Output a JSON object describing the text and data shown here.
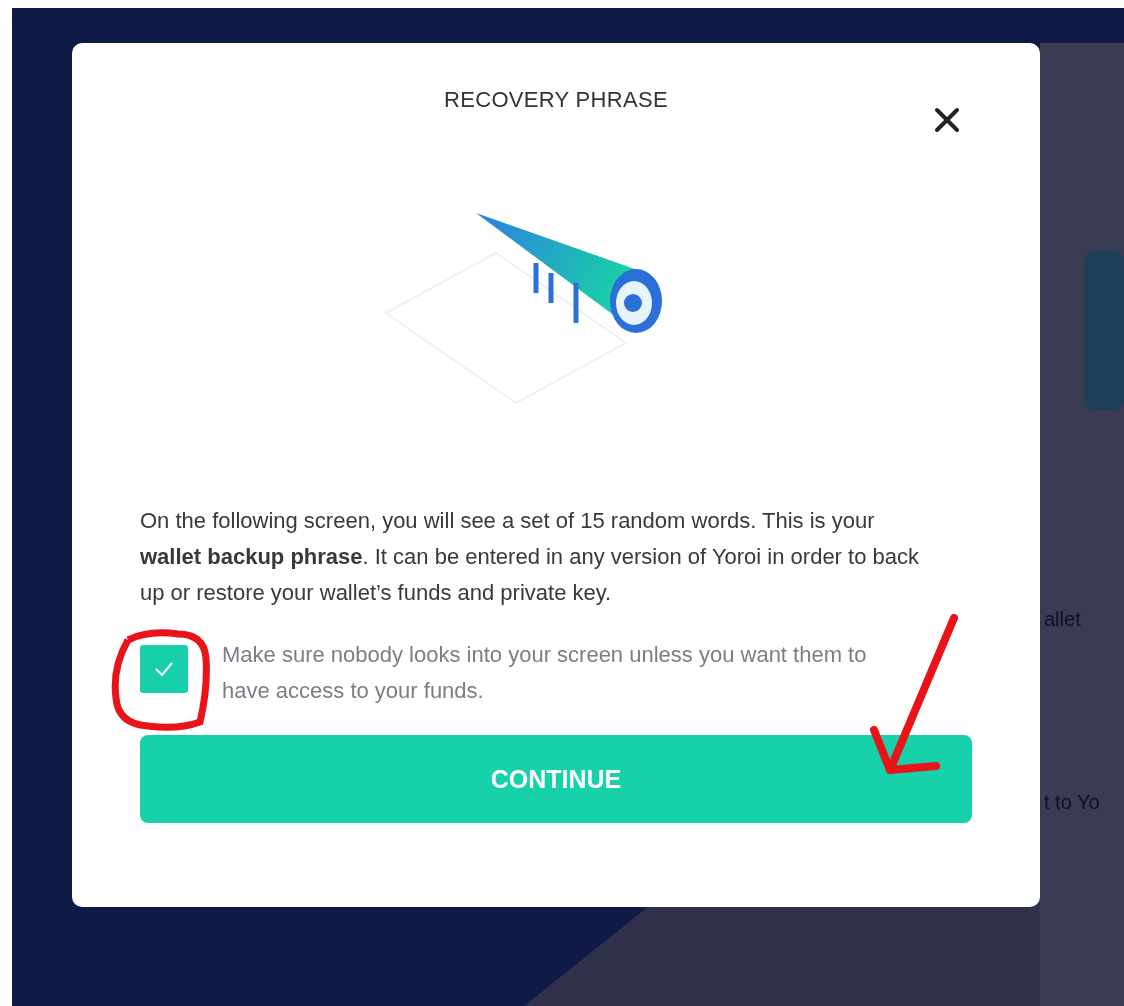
{
  "background": {
    "texts": [
      "allet",
      "t to Yo"
    ]
  },
  "dialog": {
    "title": "RECOVERY PHRASE",
    "message": "On the following screen, you will see a set of 15 random words. This is your **wallet backup phrase**. It can be entered in any version of Yoroi in order to back up or restore your wallet’s funds and private key.",
    "checkbox": {
      "label": "Make sure nobody looks into your screen unless you want them to have access to your funds.",
      "checked": true
    },
    "button": {
      "label": "CONTINUE"
    }
  }
}
